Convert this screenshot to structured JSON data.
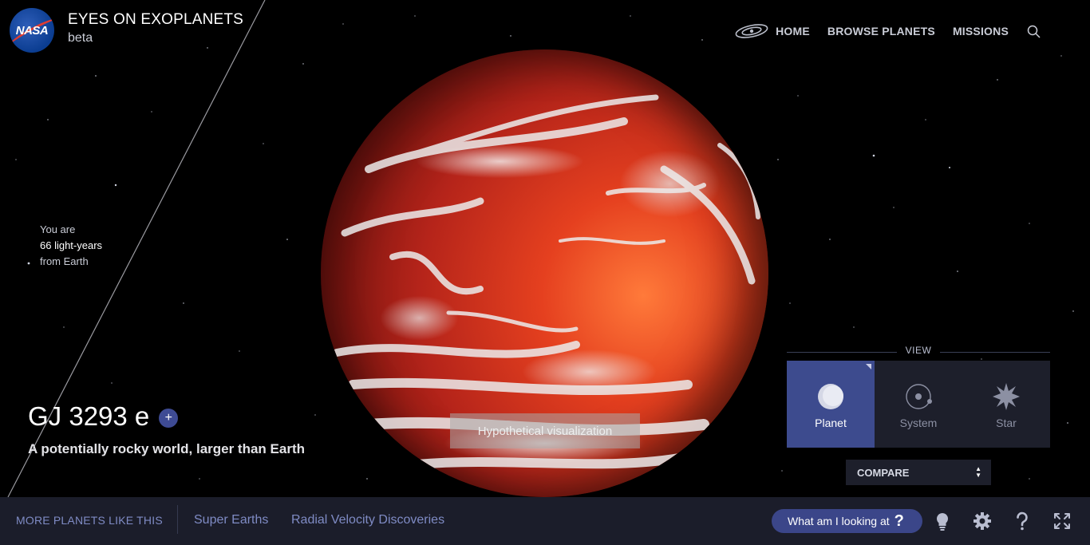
{
  "header": {
    "logo_text": "NASA",
    "title": "EYES ON EXOPLANETS",
    "subtitle": "beta",
    "nav": [
      "HOME",
      "BROWSE PLANETS",
      "MISSIONS"
    ]
  },
  "distance": {
    "line1": "You are",
    "value": "66 light-years",
    "line3": "from Earth"
  },
  "planet": {
    "name": "GJ 3293 e",
    "add_symbol": "+",
    "description": "A potentially rocky world, larger than Earth",
    "overlay": "Hypothetical visualization"
  },
  "view": {
    "label": "VIEW",
    "options": [
      "Planet",
      "System",
      "Star"
    ],
    "selected": "Planet",
    "compare": "COMPARE"
  },
  "bottom": {
    "more_label": "MORE PLANETS LIKE THIS",
    "links": [
      "Super Earths",
      "Radial Velocity Discoveries"
    ],
    "looking_button": "What am I looking at",
    "looking_symbol": "?",
    "tools": [
      "lightbulb-icon",
      "gear-icon",
      "help-icon",
      "fullscreen-icon"
    ]
  },
  "colors": {
    "bar_bg": "#1b1d2a",
    "accent": "#3d4b8e",
    "link": "#7f8bc4"
  }
}
